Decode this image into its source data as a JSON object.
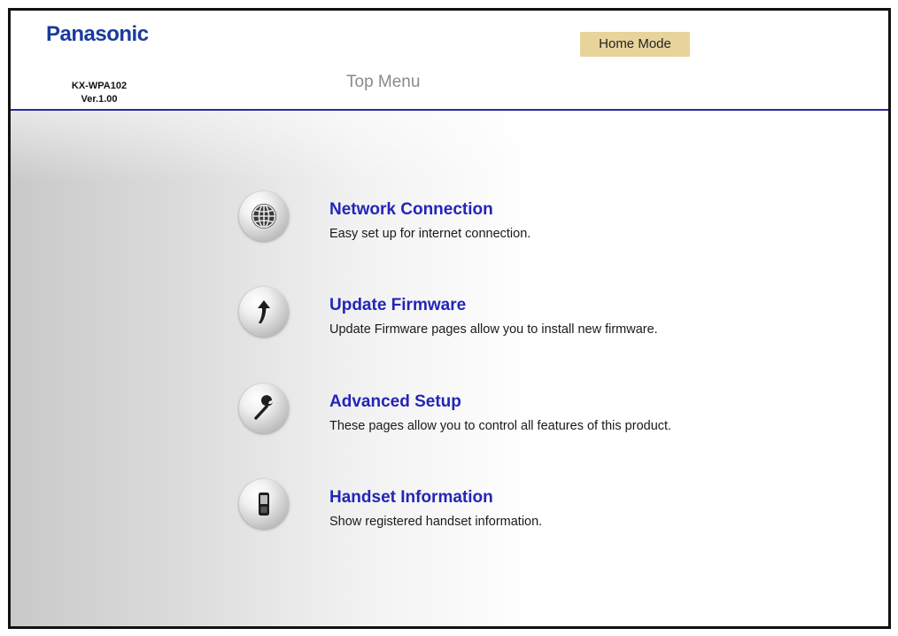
{
  "header": {
    "brand": "Panasonic",
    "model": "KX-WPA102",
    "version": "Ver.1.00",
    "mode_badge": "Home Mode",
    "page_title": "Top Menu"
  },
  "colors": {
    "brand": "#1a3a9c",
    "link": "#2424b8",
    "badge_bg": "#e8d49a",
    "divider": "#2a2a9a"
  },
  "menu": {
    "items": [
      {
        "label": "Network Connection",
        "description": "Easy set up for internet connection.",
        "icon": "globe-icon"
      },
      {
        "label": "Update Firmware",
        "description": "Update Firmware pages allow you to install new firmware.",
        "icon": "up-arrow-icon"
      },
      {
        "label": "Advanced Setup",
        "description": "These pages allow you to control all features of this product.",
        "icon": "wrench-icon"
      },
      {
        "label": "Handset Information",
        "description": "Show registered handset information.",
        "icon": "handset-icon"
      }
    ]
  }
}
